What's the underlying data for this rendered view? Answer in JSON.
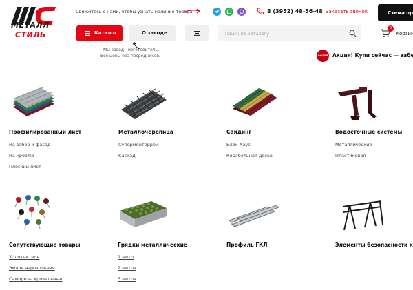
{
  "logo": {
    "line1": "МЕТАЛЛ",
    "line2": "СТИЛЬ"
  },
  "header": {
    "contact_text": "Свяжитесь с нами, чтобы узнать наличие товара",
    "messengers": [
      "telegram-icon",
      "whatsapp-icon",
      "viber-icon"
    ],
    "phone": "8 (3952) 48-56-48",
    "callback_label": "Заказать звонок",
    "scheme_label": "Схема проезда"
  },
  "nav": {
    "catalog_label": "Каталог",
    "about_label": "О заводе",
    "search_placeholder": "Поиск по каталогу",
    "cart_count": "0",
    "cart_label": "Корзина"
  },
  "about_tip": {
    "line1": "Мы завод - изготовитель.",
    "line2": "Все цены без посредников."
  },
  "promo": {
    "badge": "АКЦИЯ",
    "text": "Акция! Купи сейчас — заберешь"
  },
  "catalog": [
    {
      "title": "Профилированный лист",
      "links": [
        "На забор и фасад",
        "На кровлю",
        "Плоский лист"
      ]
    },
    {
      "title": "Металлочерепица",
      "links": [
        "Супермонтеррей",
        "Каскад"
      ]
    },
    {
      "title": "Сайдинг",
      "links": [
        "Блок-Хаус",
        "Корабельная доска"
      ]
    },
    {
      "title": "Водосточные системы",
      "links": [
        "Металлические",
        "Пластиковая"
      ]
    },
    {
      "title": "Сопутствующие товары",
      "links": [
        "Уплотнитель",
        "Эмаль аэрозольная",
        "Саморезы кровельные"
      ]
    },
    {
      "title": "Грядки металлические",
      "links": [
        "1 метр",
        "2 метра",
        "3 метра"
      ]
    },
    {
      "title": "Профиль ГКЛ",
      "links": []
    },
    {
      "title": "Элементы безопасности кровли",
      "links": []
    }
  ],
  "colors": {
    "brand_red": "#e30613",
    "dark": "#111111",
    "button_grey": "#efefef"
  }
}
